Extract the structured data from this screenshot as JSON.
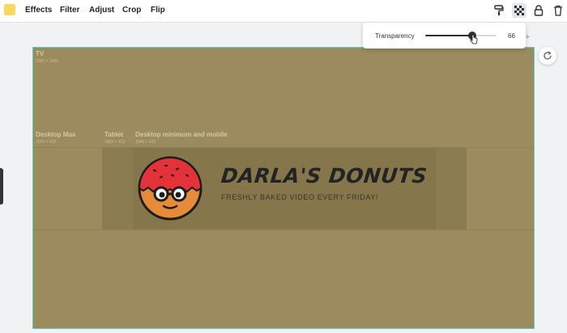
{
  "toolbar": {
    "color_swatch": "#f9d65c",
    "menu": [
      "Effects",
      "Filter",
      "Adjust",
      "Crop",
      "Flip"
    ],
    "icons": [
      "paint-roller-icon",
      "transparency-checker-icon",
      "unlock-icon",
      "trash-icon"
    ]
  },
  "transparency": {
    "label": "Transparency",
    "value": "66",
    "level_percent": 66
  },
  "canvas": {
    "background_color": "#9b8b5f",
    "zones": [
      {
        "label": "TV",
        "size": "2560 × 1440"
      },
      {
        "label": "Desktop Max",
        "size": "2560 × 423"
      },
      {
        "label": "Tablet",
        "size": "1855 × 423"
      },
      {
        "label": "Desktop minimum and mobile",
        "size": "1546 × 423"
      }
    ],
    "banner": {
      "title": "DARLA'S DONUTS",
      "subtitle": "FRESHLY BAKED VIDEO EVERY FRIDAY!"
    }
  },
  "colors": {
    "accent_teal": "#55d1c3",
    "donut_frosting": "#e3323a",
    "donut_dough": "#e58b3a"
  }
}
